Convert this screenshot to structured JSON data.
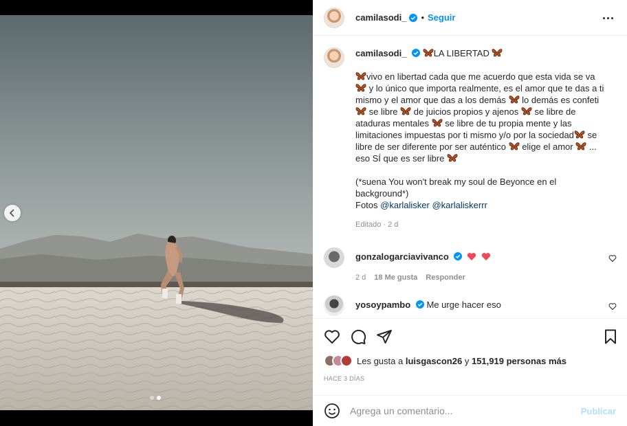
{
  "post": {
    "username": "camilasodi_",
    "separator": "•",
    "follow_label": "Seguir",
    "photo_alt_icon": "sand-dune-photo",
    "carousel": {
      "count": 2,
      "active": 1
    }
  },
  "caption": {
    "username": "camilasodi_",
    "title": "LA LIBERTAD",
    "segments": [
      {
        "t": "b"
      },
      {
        "t": "s",
        "v": "vivo en libertad cada que me acuerdo que esta vida se va "
      },
      {
        "t": "b"
      },
      {
        "t": "s",
        "v": " y lo único que importa realmente, es el amor que te das a ti mismo y el amor que das a los demás "
      },
      {
        "t": "b"
      },
      {
        "t": "s",
        "v": " lo demás es confeti "
      },
      {
        "t": "b"
      },
      {
        "t": "s",
        "v": " se libre "
      },
      {
        "t": "b"
      },
      {
        "t": "s",
        "v": " de juicios propios y ajenos "
      },
      {
        "t": "b"
      },
      {
        "t": "s",
        "v": " se libre de ataduras mentales "
      },
      {
        "t": "b"
      },
      {
        "t": "s",
        "v": " se libre de tu propia mente y las limitaciones impuestas por ti mismo y/o por la sociedad"
      },
      {
        "t": "b"
      },
      {
        "t": "s",
        "v": " se libre de ser diferente por ser auténtico "
      },
      {
        "t": "b"
      },
      {
        "t": "s",
        "v": " elige el amor "
      },
      {
        "t": "b"
      },
      {
        "t": "s",
        "v": " ... eso SÍ que es ser libre "
      },
      {
        "t": "b"
      }
    ],
    "song_note": "(*suena You won't break my soul de Beyonce en el background*)",
    "photos_label": "Fotos",
    "mention_1": "@karlalisker",
    "mention_2": "@karlaliskerrr",
    "edited": "Editado · 2 d"
  },
  "comments": [
    {
      "username": "gonzalogarciavivanco",
      "hearts": 2,
      "time": "2 d",
      "likes": "18 Me gusta",
      "reply": "Responder"
    },
    {
      "username": "yosoypambo",
      "text": "Me urge hacer eso"
    }
  ],
  "likes": {
    "prefix": "Les gusta a",
    "user": "luisgascon26",
    "connector": "y",
    "count": "151,919 personas más"
  },
  "posted_time": "HACE 3 DÍAS",
  "composer": {
    "placeholder": "Agrega un comentario...",
    "post_label": "Publicar"
  },
  "colors": {
    "accent": "#0095f6",
    "post_disabled": "#b2dffc",
    "butterfly": "#c0521f",
    "heart_red": "#ed4956"
  }
}
